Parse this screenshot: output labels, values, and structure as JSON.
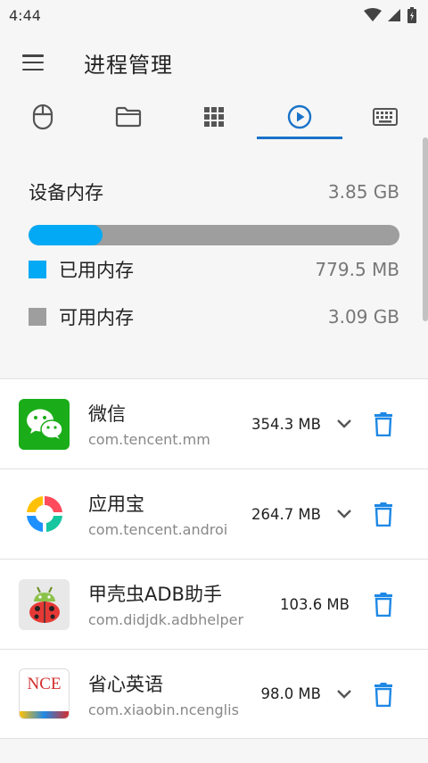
{
  "status_bar": {
    "time": "4:44"
  },
  "app_bar": {
    "title": "进程管理"
  },
  "tabs": [
    {
      "name": "mouse",
      "icon": "mouse-icon"
    },
    {
      "name": "files",
      "icon": "folder-icon"
    },
    {
      "name": "apps",
      "icon": "grid-icon"
    },
    {
      "name": "processes",
      "icon": "play-circle-icon",
      "active": true
    },
    {
      "name": "keyboard",
      "icon": "keyboard-icon"
    }
  ],
  "memory": {
    "title": "设备内存",
    "total": "3.85 GB",
    "used_fraction": 0.2,
    "used_label": "已用内存",
    "used_value": "779.5 MB",
    "free_label": "可用内存",
    "free_value": "3.09 GB",
    "colors": {
      "used": "#03a9f4",
      "free": "#9e9e9e"
    }
  },
  "apps": [
    {
      "name": "微信",
      "package": "com.tencent.mm",
      "size": "354.3 MB",
      "icon": "wechat-icon",
      "expandable": true
    },
    {
      "name": "应用宝",
      "package": "com.tencent.androi",
      "size": "264.7 MB",
      "icon": "yingyongbao-icon",
      "expandable": true
    },
    {
      "name": "甲壳虫ADB助手",
      "package": "com.didjdk.adbhelper",
      "size": "103.6 MB",
      "icon": "ladybug-android-icon",
      "expandable": false
    },
    {
      "name": "省心英语",
      "package": "com.xiaobin.ncenglis",
      "size": "98.0 MB",
      "icon": "nce-icon",
      "icon_text": "NCE",
      "expandable": true
    }
  ],
  "accent": "#1a73c8",
  "delete_color": "#1e88e5"
}
